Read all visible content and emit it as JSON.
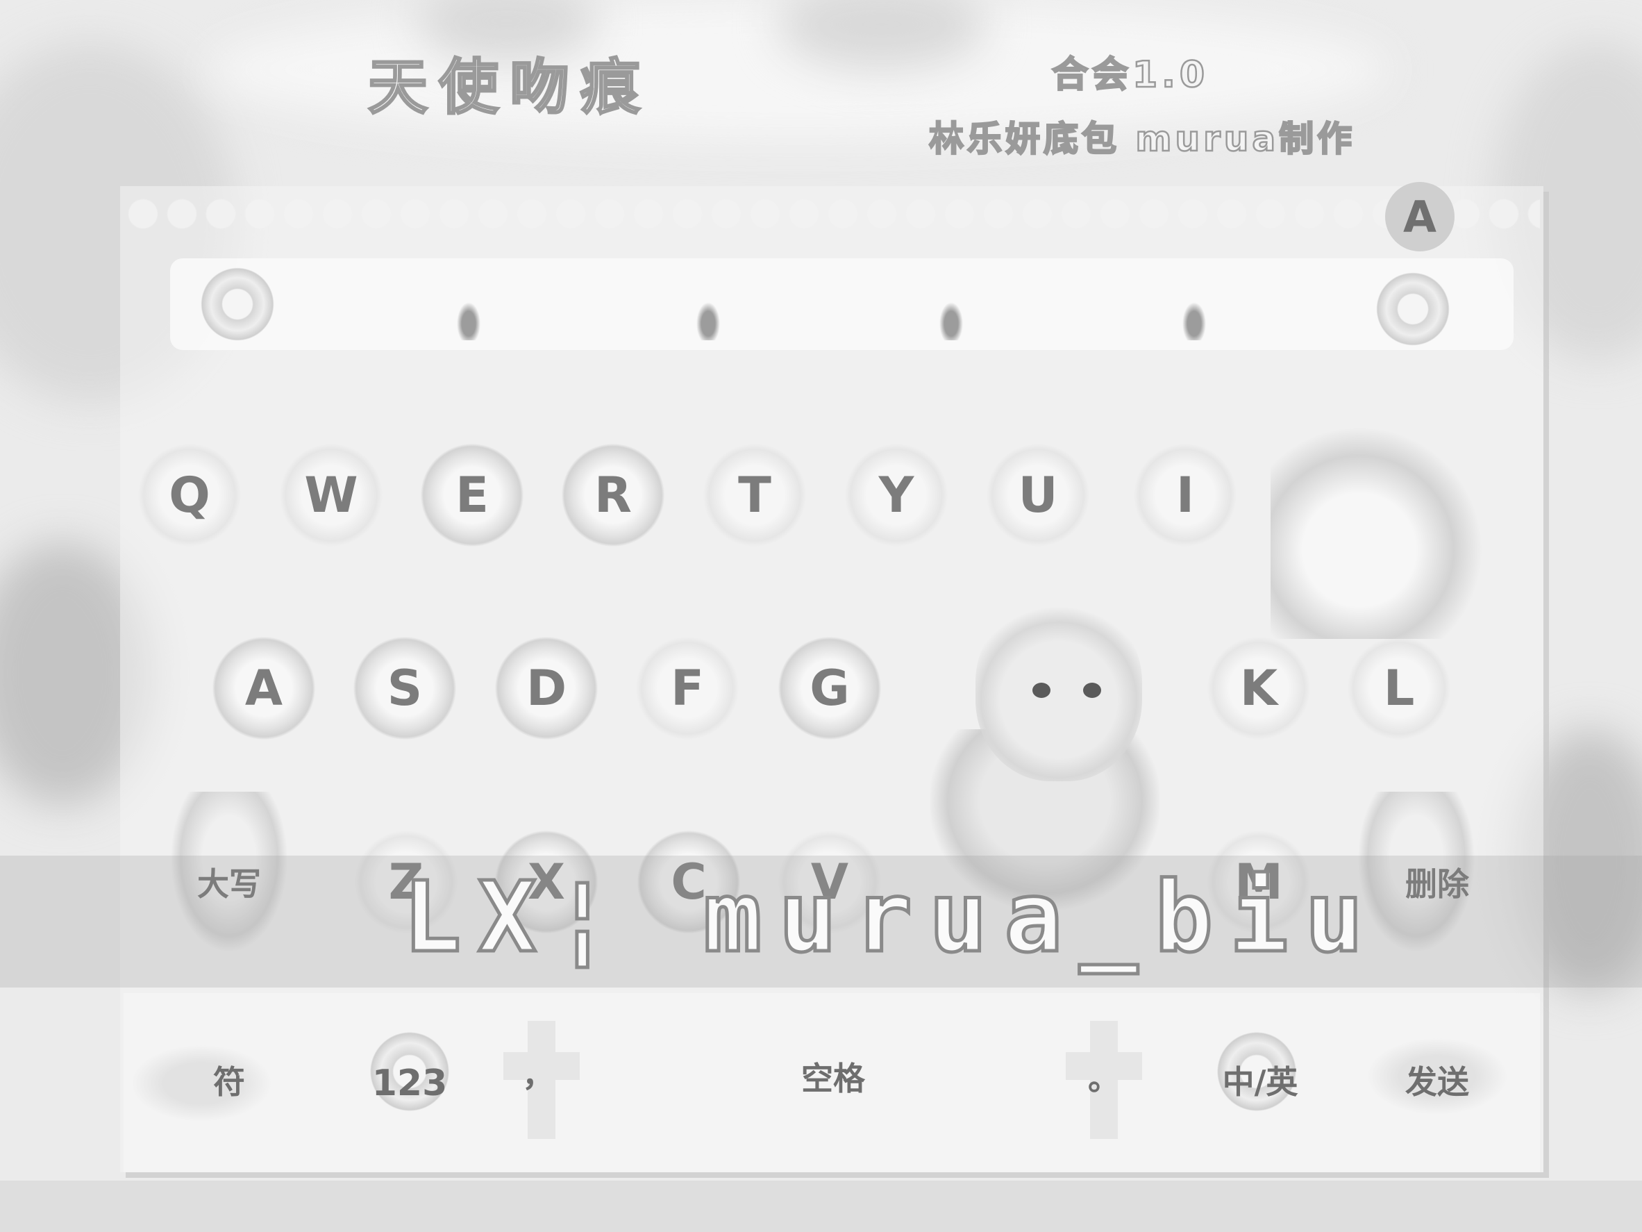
{
  "header": {
    "theme_title": "天使吻痕",
    "collection": "合会1.0",
    "credit": "林乐妍底包 murua制作"
  },
  "keyboard": {
    "row1": [
      "Q",
      "W",
      "E",
      "R",
      "T",
      "Y",
      "U",
      "I"
    ],
    "row2": [
      "A",
      "S",
      "D",
      "F",
      "G",
      "K",
      "L"
    ],
    "row3": [
      "Z",
      "X",
      "C",
      "V",
      "M"
    ],
    "caps_label": "大写",
    "delete_label": "删除",
    "symbol_label": "符",
    "numbers_label": "123",
    "comma_label": "，",
    "space_label": "空格",
    "period_label": "。",
    "lang_label": "中/英",
    "send_label": "发送"
  },
  "logo_letter": "A",
  "watermark": "LX¦ murua_biu"
}
